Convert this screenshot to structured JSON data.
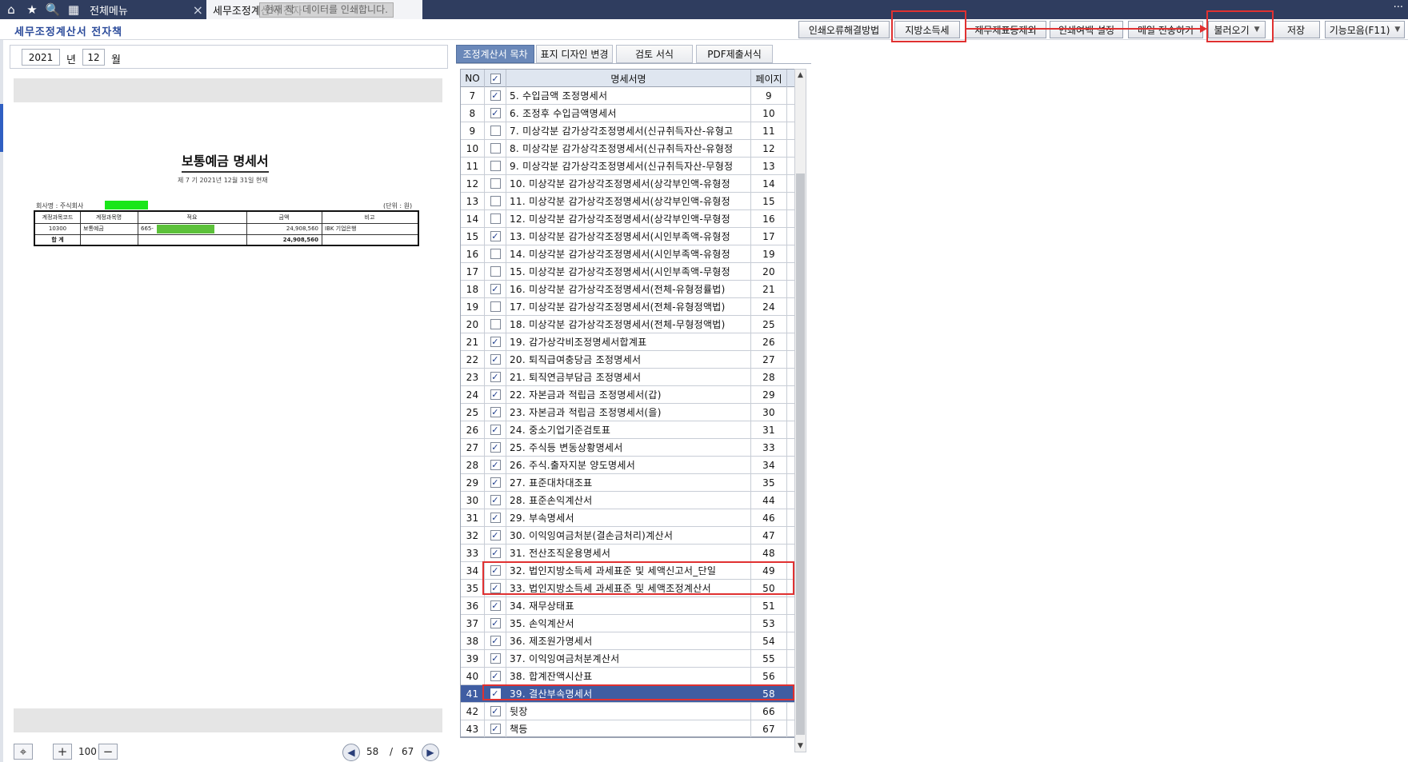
{
  "topbar": {
    "icons": [
      "home-icon",
      "star-icon",
      "search-icon",
      "calendar-icon"
    ],
    "tab_menu": "전체메뉴",
    "tab_active": "세무조정계산서 전자",
    "tooltip_prefix": "현재 작",
    "tooltip_text": "데이터를 인쇄합니다."
  },
  "header": {
    "title": "세무조정계산서 전자책",
    "buttons": {
      "print_error": "인쇄오류해결방법",
      "local_tax": "지방소득세",
      "exclude_fs": "재무제표등제외",
      "print_margin": "인쇄여백 설정",
      "email": "메일 전송하기",
      "load": "불러오기",
      "save": "저장",
      "functions": "기능모음(F11)"
    }
  },
  "date": {
    "year": "2021",
    "year_label": "년",
    "month": "12",
    "month_label": "월"
  },
  "document": {
    "title": "보통예금 명세서",
    "subtitle": "제 7 기 2021년 12월 31일 현재",
    "company_label": "회사명 : 주식회사",
    "unit": "(단위 : 원)",
    "headers": [
      "계정과목코드",
      "계정과목명",
      "적요",
      "금액",
      "비고"
    ],
    "row": {
      "code": "10300",
      "name": "보통예금",
      "memo": "665-",
      "amount": "24,908,560",
      "note": "IBK 기업은행"
    },
    "total_label": "합 계",
    "total_amount": "24,908,560"
  },
  "controls": {
    "zoom": "100",
    "current_page": "58",
    "separator": "/",
    "total_pages": "67"
  },
  "right_tabs": [
    "조정계산서 목차",
    "표지 디자인 변경",
    "검토 서식",
    "PDF제출서식"
  ],
  "grid": {
    "headers": {
      "no": "NO",
      "name": "명세서명",
      "page": "페이지"
    },
    "rows": [
      {
        "no": "7",
        "checked": true,
        "name": "5. 수입금액 조정명세서",
        "page": "9"
      },
      {
        "no": "8",
        "checked": true,
        "name": "6. 조정후 수입금액명세서",
        "page": "10"
      },
      {
        "no": "9",
        "checked": false,
        "name": "7. 미상각분 감가상각조정명세서(신규취득자산-유형고",
        "page": "11"
      },
      {
        "no": "10",
        "checked": false,
        "name": "8. 미상각분 감가상각조정명세서(신규취득자산-유형정",
        "page": "12"
      },
      {
        "no": "11",
        "checked": false,
        "name": "9. 미상각분 감가상각조정명세서(신규취득자산-무형정",
        "page": "13"
      },
      {
        "no": "12",
        "checked": false,
        "name": "10. 미상각분 감가상각조정명세서(상각부인액-유형정",
        "page": "14"
      },
      {
        "no": "13",
        "checked": false,
        "name": "11. 미상각분 감가상각조정명세서(상각부인액-유형정",
        "page": "15"
      },
      {
        "no": "14",
        "checked": false,
        "name": "12. 미상각분 감가상각조정명세서(상각부인액-무형정",
        "page": "16"
      },
      {
        "no": "15",
        "checked": true,
        "name": "13. 미상각분 감가상각조정명세서(시인부족액-유형정",
        "page": "17"
      },
      {
        "no": "16",
        "checked": false,
        "name": "14. 미상각분 감가상각조정명세서(시인부족액-유형정",
        "page": "19"
      },
      {
        "no": "17",
        "checked": false,
        "name": "15. 미상각분 감가상각조정명세서(시인부족액-무형정",
        "page": "20"
      },
      {
        "no": "18",
        "checked": true,
        "name": "16. 미상각분 감가상각조정명세서(전체-유형정률법)",
        "page": "21"
      },
      {
        "no": "19",
        "checked": false,
        "name": "17. 미상각분 감가상각조정명세서(전체-유형정액법)",
        "page": "24"
      },
      {
        "no": "20",
        "checked": false,
        "name": "18. 미상각분 감가상각조정명세서(전체-무형정액법)",
        "page": "25"
      },
      {
        "no": "21",
        "checked": true,
        "name": "19. 감가상각비조정명세서합계표",
        "page": "26"
      },
      {
        "no": "22",
        "checked": true,
        "name": "20. 퇴직급여충당금 조정명세서",
        "page": "27"
      },
      {
        "no": "23",
        "checked": true,
        "name": "21. 퇴직연금부담금 조정명세서",
        "page": "28"
      },
      {
        "no": "24",
        "checked": true,
        "name": "22. 자본금과 적립금 조정명세서(갑)",
        "page": "29"
      },
      {
        "no": "25",
        "checked": true,
        "name": "23. 자본금과 적립금 조정명세서(을)",
        "page": "30"
      },
      {
        "no": "26",
        "checked": true,
        "name": "24. 중소기업기준검토표",
        "page": "31"
      },
      {
        "no": "27",
        "checked": true,
        "name": "25. 주식등 변동상황명세서",
        "page": "33"
      },
      {
        "no": "28",
        "checked": true,
        "name": "26. 주식.출자지분 양도명세서",
        "page": "34"
      },
      {
        "no": "29",
        "checked": true,
        "name": "27. 표준대차대조표",
        "page": "35"
      },
      {
        "no": "30",
        "checked": true,
        "name": "28. 표준손익계산서",
        "page": "44"
      },
      {
        "no": "31",
        "checked": true,
        "name": "29. 부속명세서",
        "page": "46"
      },
      {
        "no": "32",
        "checked": true,
        "name": "30. 이익잉여금처분(결손금처리)계산서",
        "page": "47"
      },
      {
        "no": "33",
        "checked": true,
        "name": "31. 전산조직운용명세서",
        "page": "48"
      },
      {
        "no": "34",
        "checked": true,
        "name": "32. 법인지방소득세 과세표준 및 세액신고서_단일",
        "page": "49"
      },
      {
        "no": "35",
        "checked": true,
        "name": "33. 법인지방소득세 과세표준 및 세액조정계산서",
        "page": "50"
      },
      {
        "no": "36",
        "checked": true,
        "name": "34. 재무상태표",
        "page": "51"
      },
      {
        "no": "37",
        "checked": true,
        "name": "35. 손익계산서",
        "page": "53"
      },
      {
        "no": "38",
        "checked": true,
        "name": "36. 제조원가명세서",
        "page": "54"
      },
      {
        "no": "39",
        "checked": true,
        "name": "37. 이익잉여금처분계산서",
        "page": "55"
      },
      {
        "no": "40",
        "checked": true,
        "name": "38. 합계잔액시산표",
        "page": "56"
      },
      {
        "no": "41",
        "checked": true,
        "name": "39. 결산부속명세서",
        "page": "58"
      },
      {
        "no": "42",
        "checked": true,
        "name": "뒷장",
        "page": "66"
      },
      {
        "no": "43",
        "checked": true,
        "name": "책등",
        "page": "67"
      }
    ]
  },
  "colors": {
    "accent": "#3f5da2",
    "highlight": "#e03131",
    "topbar": "#2f3d5f"
  }
}
